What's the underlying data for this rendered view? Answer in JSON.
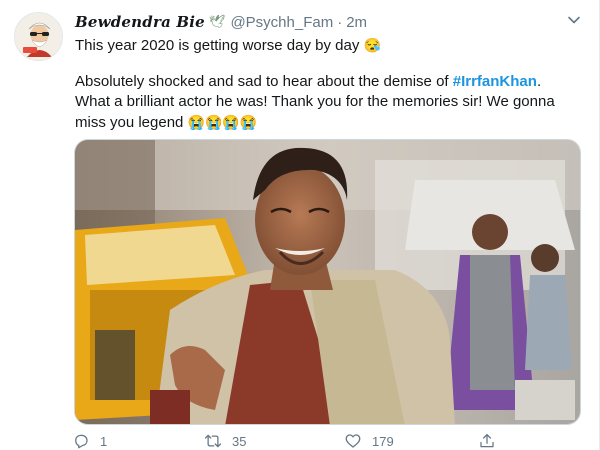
{
  "tweet": {
    "display_name": "Bewdendra Bie",
    "name_emoji": "🕊",
    "handle": "@Psychh_Fam",
    "separator": "·",
    "time": "2m",
    "line1": "This year 2020 is getting worse day by day",
    "line1_emoji": "😪",
    "para2_before": "Absolutely shocked and sad to hear about the demise of ",
    "hashtag": "#IrrfanKhan",
    "para2_after": ". What a brilliant actor he was! Thank you for the memories sir! We gonna miss you legend ",
    "para2_emoji": "😭😭😭😭"
  },
  "actions": {
    "reply_count": "1",
    "retweet_count": "35",
    "like_count": "179"
  },
  "icons": {
    "more": "chevron-down-icon",
    "reply": "reply-icon",
    "retweet": "retweet-icon",
    "like": "heart-icon",
    "share": "share-icon"
  },
  "colors": {
    "hashtag": "#1b95e0",
    "secondary_text": "#657786",
    "border": "#e6ecf0"
  }
}
